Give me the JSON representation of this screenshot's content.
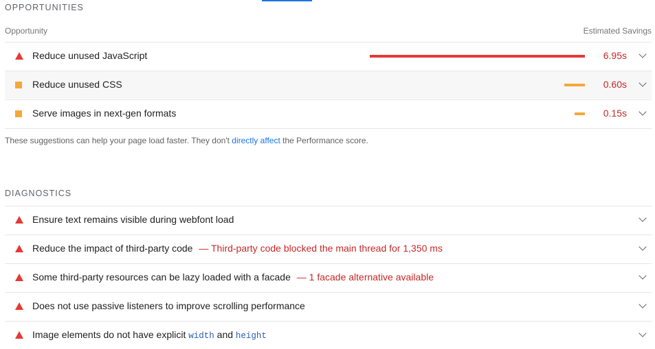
{
  "opportunities": {
    "title": "OPPORTUNITIES",
    "col_left": "Opportunity",
    "col_right": "Estimated Savings",
    "items": [
      {
        "label": "Reduce unused JavaScript",
        "value": "6.95s",
        "savings_seconds": 6.95,
        "severity": "fail",
        "icon": "red-triangle-icon"
      },
      {
        "label": "Reduce unused CSS",
        "value": "0.60s",
        "savings_seconds": 0.6,
        "severity": "average",
        "icon": "orange-square-icon"
      },
      {
        "label": "Serve images in next-gen formats",
        "value": "0.15s",
        "savings_seconds": 0.15,
        "severity": "average",
        "icon": "orange-square-icon"
      }
    ],
    "footnote_pre": "These suggestions can help your page load faster. They don't",
    "footnote_link1": "directly",
    "footnote_link2": "affect",
    "footnote_post": "the Performance score."
  },
  "diagnostics": {
    "title": "DIAGNOSTICS",
    "items": [
      {
        "label": "Ensure text remains visible during webfont load",
        "note": ""
      },
      {
        "label": "Reduce the impact of third-party code",
        "note": "— Third-party code blocked the main thread for 1,350 ms"
      },
      {
        "label": "Some third-party resources can be lazy loaded with a facade",
        "note": "— 1 facade alternative available"
      },
      {
        "label": "Does not use passive listeners to improve scrolling performance",
        "note": ""
      },
      {
        "label_pre": "Image elements do not have explicit",
        "code1": "width",
        "mid": "and",
        "code2": "height"
      }
    ]
  },
  "colors": {
    "fail": "#e53935",
    "average": "#f4a83a",
    "link": "#1a73e8",
    "note": "#c62828"
  }
}
